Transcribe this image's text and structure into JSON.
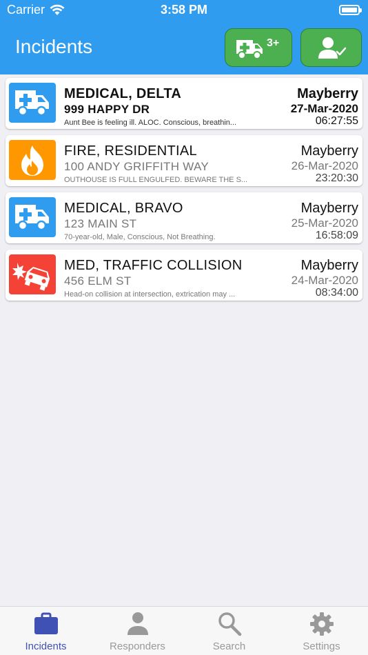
{
  "status_bar": {
    "carrier": "Carrier",
    "time": "3:58 PM"
  },
  "header": {
    "title": "Incidents",
    "ambulance_badge": "3+"
  },
  "colors": {
    "header": "#2f9cf0",
    "medical": "#2f9cf0",
    "fire": "#ff9800",
    "collision": "#f44336",
    "button_green": "#4caf50",
    "tab_active": "#3f51b5"
  },
  "incidents": [
    {
      "type": "MEDICAL, DELTA",
      "address": "999 HAPPY DR",
      "note": "Aunt Bee is feeling ill.  ALOC.  Conscious, breathin...",
      "city": "Mayberry",
      "date": "27-Mar-2020",
      "time": "06:27:55",
      "icon": "ambulance-icon",
      "unread": true
    },
    {
      "type": "FIRE, RESIDENTIAL",
      "address": "100 ANDY GRIFFITH WAY",
      "note": "OUTHOUSE IS FULL ENGULFED.  BEWARE THE S...",
      "city": "Mayberry",
      "date": "26-Mar-2020",
      "time": "23:20:30",
      "icon": "fire-icon",
      "unread": false
    },
    {
      "type": "MEDICAL, BRAVO",
      "address": "123 MAIN ST",
      "note": "70-year-old, Male, Conscious, Not Breathing.",
      "city": "Mayberry",
      "date": "25-Mar-2020",
      "time": "16:58:09",
      "icon": "ambulance-icon",
      "unread": false
    },
    {
      "type": "MED, TRAFFIC COLLISION",
      "address": "456 ELM ST",
      "note": "Head-on collision at intersection, extrication may ...",
      "city": "Mayberry",
      "date": "24-Mar-2020",
      "time": "08:34:00",
      "icon": "car-crash-icon",
      "unread": false
    }
  ],
  "tabs": [
    {
      "label": "Incidents",
      "icon": "briefcase-icon",
      "active": true
    },
    {
      "label": "Responders",
      "icon": "person-icon",
      "active": false
    },
    {
      "label": "Search",
      "icon": "search-icon",
      "active": false
    },
    {
      "label": "Settings",
      "icon": "gear-icon",
      "active": false
    }
  ]
}
